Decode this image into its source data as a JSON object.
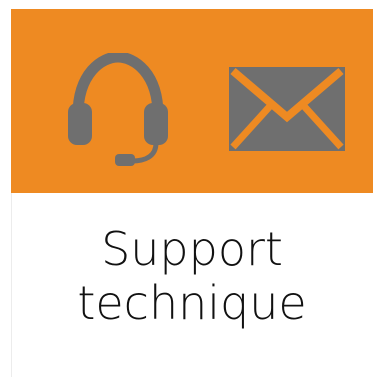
{
  "tile": {
    "line1": "Support",
    "line2": "technique"
  },
  "icons": {
    "left": "headset-icon",
    "right": "envelope-icon"
  },
  "colors": {
    "banner": "#ee8a22",
    "icon": "#6f6f6f",
    "text": "#111111"
  }
}
